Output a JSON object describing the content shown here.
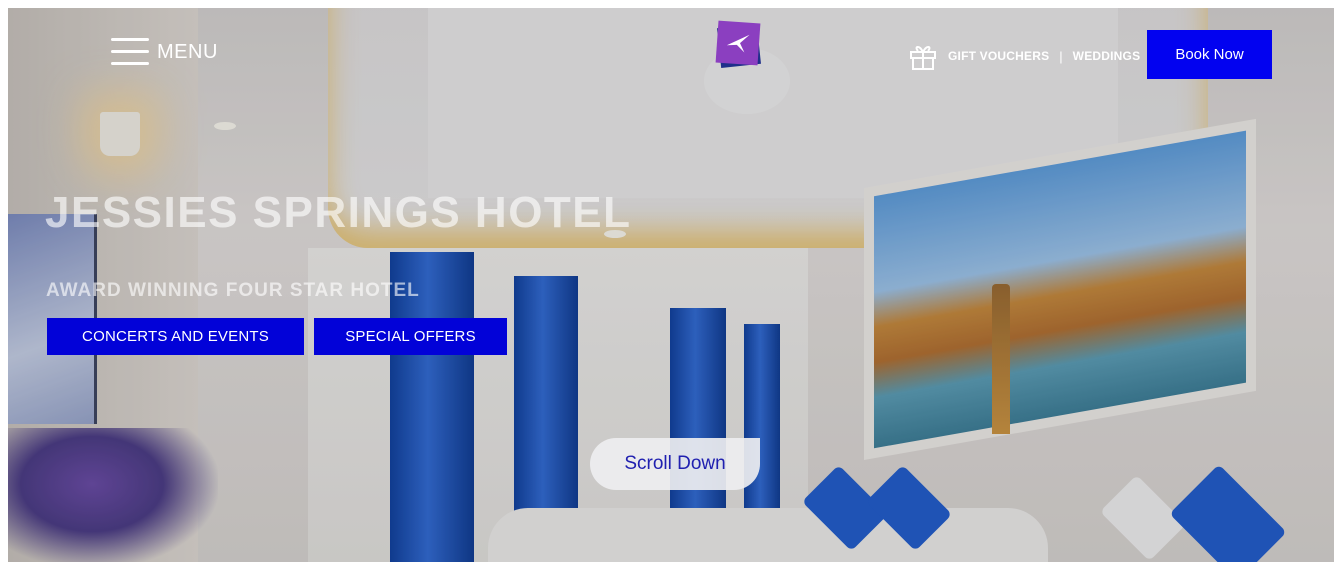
{
  "header": {
    "menu_label": "MENU",
    "links": [
      {
        "label": "GIFT VOUCHERS"
      },
      {
        "label": "WEDDINGS"
      }
    ],
    "separator": "|",
    "book_label": "Book Now",
    "gift_icon": "gift-icon",
    "logo_icon": "bird-logo-icon"
  },
  "hero": {
    "title": "JESSIES SPRINGS HOTEL",
    "subtitle": "AWARD WINNING FOUR STAR HOTEL",
    "buttons": [
      {
        "label": "CONCERTS AND EVENTS"
      },
      {
        "label": "SPECIAL OFFERS"
      }
    ],
    "scroll_label": "Scroll Down"
  },
  "colors": {
    "primary_button": "#0202f0",
    "cta_button": "#0202d8",
    "scroll_text": "#2020b0",
    "logo_purple": "#8b3fc0"
  }
}
